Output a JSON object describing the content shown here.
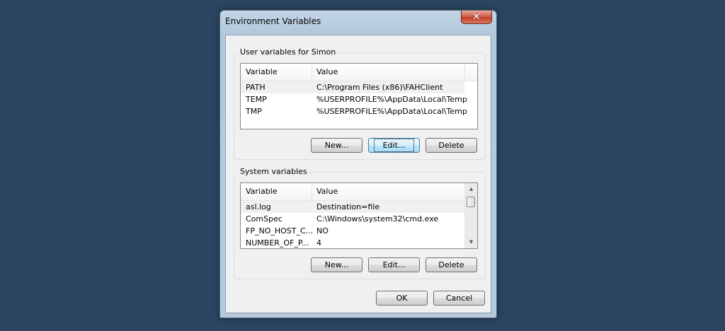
{
  "window": {
    "title": "Environment Variables",
    "close_glyph": "✕"
  },
  "user_vars": {
    "group_label": "User variables for Simon",
    "columns": [
      "Variable",
      "Value"
    ],
    "rows": [
      {
        "variable": "PATH",
        "value": "C:\\Program Files (x86)\\FAHClient"
      },
      {
        "variable": "TEMP",
        "value": "%USERPROFILE%\\AppData\\Local\\Temp"
      },
      {
        "variable": "TMP",
        "value": "%USERPROFILE%\\AppData\\Local\\Temp"
      }
    ],
    "buttons": {
      "new": "New...",
      "edit": "Edit...",
      "delete": "Delete"
    }
  },
  "system_vars": {
    "group_label": "System variables",
    "columns": [
      "Variable",
      "Value"
    ],
    "rows": [
      {
        "variable": "asl.log",
        "value": "Destination=file"
      },
      {
        "variable": "ComSpec",
        "value": "C:\\Windows\\system32\\cmd.exe"
      },
      {
        "variable": "FP_NO_HOST_C...",
        "value": "NO"
      },
      {
        "variable": "NUMBER_OF_P...",
        "value": "4"
      }
    ],
    "buttons": {
      "new": "New...",
      "edit": "Edit...",
      "delete": "Delete"
    }
  },
  "footer": {
    "ok": "OK",
    "cancel": "Cancel"
  },
  "colors": {
    "desktop": "#2c4662",
    "window_frame": "#b6cadf",
    "close_button": "#c2402b"
  }
}
